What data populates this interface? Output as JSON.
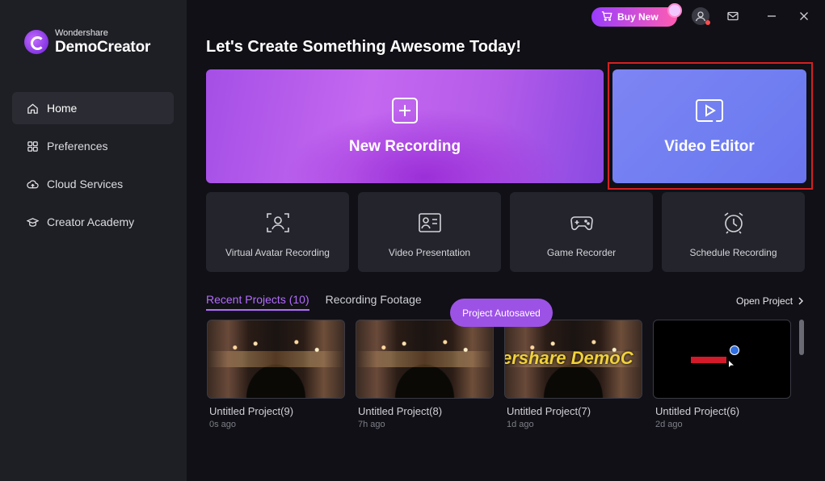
{
  "app": {
    "brand": "Wondershare",
    "product": "DemoCreator"
  },
  "topbar": {
    "buy_label": "Buy New"
  },
  "sidebar": {
    "items": [
      {
        "label": "Home",
        "icon": "home-icon",
        "active": true
      },
      {
        "label": "Preferences",
        "icon": "grid-icon",
        "active": false
      },
      {
        "label": "Cloud Services",
        "icon": "cloud-icon",
        "active": false
      },
      {
        "label": "Creator Academy",
        "icon": "graduation-cap-icon",
        "active": false
      }
    ]
  },
  "main": {
    "heading": "Let's Create Something Awesome Today!",
    "big_cards": [
      {
        "label": "New Recording",
        "icon": "plus-icon"
      },
      {
        "label": "Video Editor",
        "icon": "play-icon"
      }
    ],
    "small_cards": [
      {
        "label": "Virtual Avatar Recording",
        "icon": "avatar-frame-icon"
      },
      {
        "label": "Video Presentation",
        "icon": "presentation-icon"
      },
      {
        "label": "Game Recorder",
        "icon": "gamepad-icon"
      },
      {
        "label": "Schedule Recording",
        "icon": "alarm-clock-icon"
      }
    ],
    "tabs": [
      {
        "label": "Recent Projects (10)",
        "active": true
      },
      {
        "label": "Recording Footage",
        "active": false
      }
    ],
    "open_project_label": "Open Project",
    "toast": "Project Autosaved",
    "projects": [
      {
        "name": "Untitled Project(9)",
        "time": "0s ago"
      },
      {
        "name": "Untitled Project(8)",
        "time": "7h ago"
      },
      {
        "name": "Untitled Project(7)",
        "time": "1d ago",
        "overlay_text": "ershare DemoC"
      },
      {
        "name": "Untitled Project(6)",
        "time": "2d ago"
      }
    ]
  },
  "colors": {
    "accent": "#b46cff",
    "sidebar_bg": "#1e1e25",
    "main_bg": "#101016",
    "highlight": "#d42020"
  }
}
